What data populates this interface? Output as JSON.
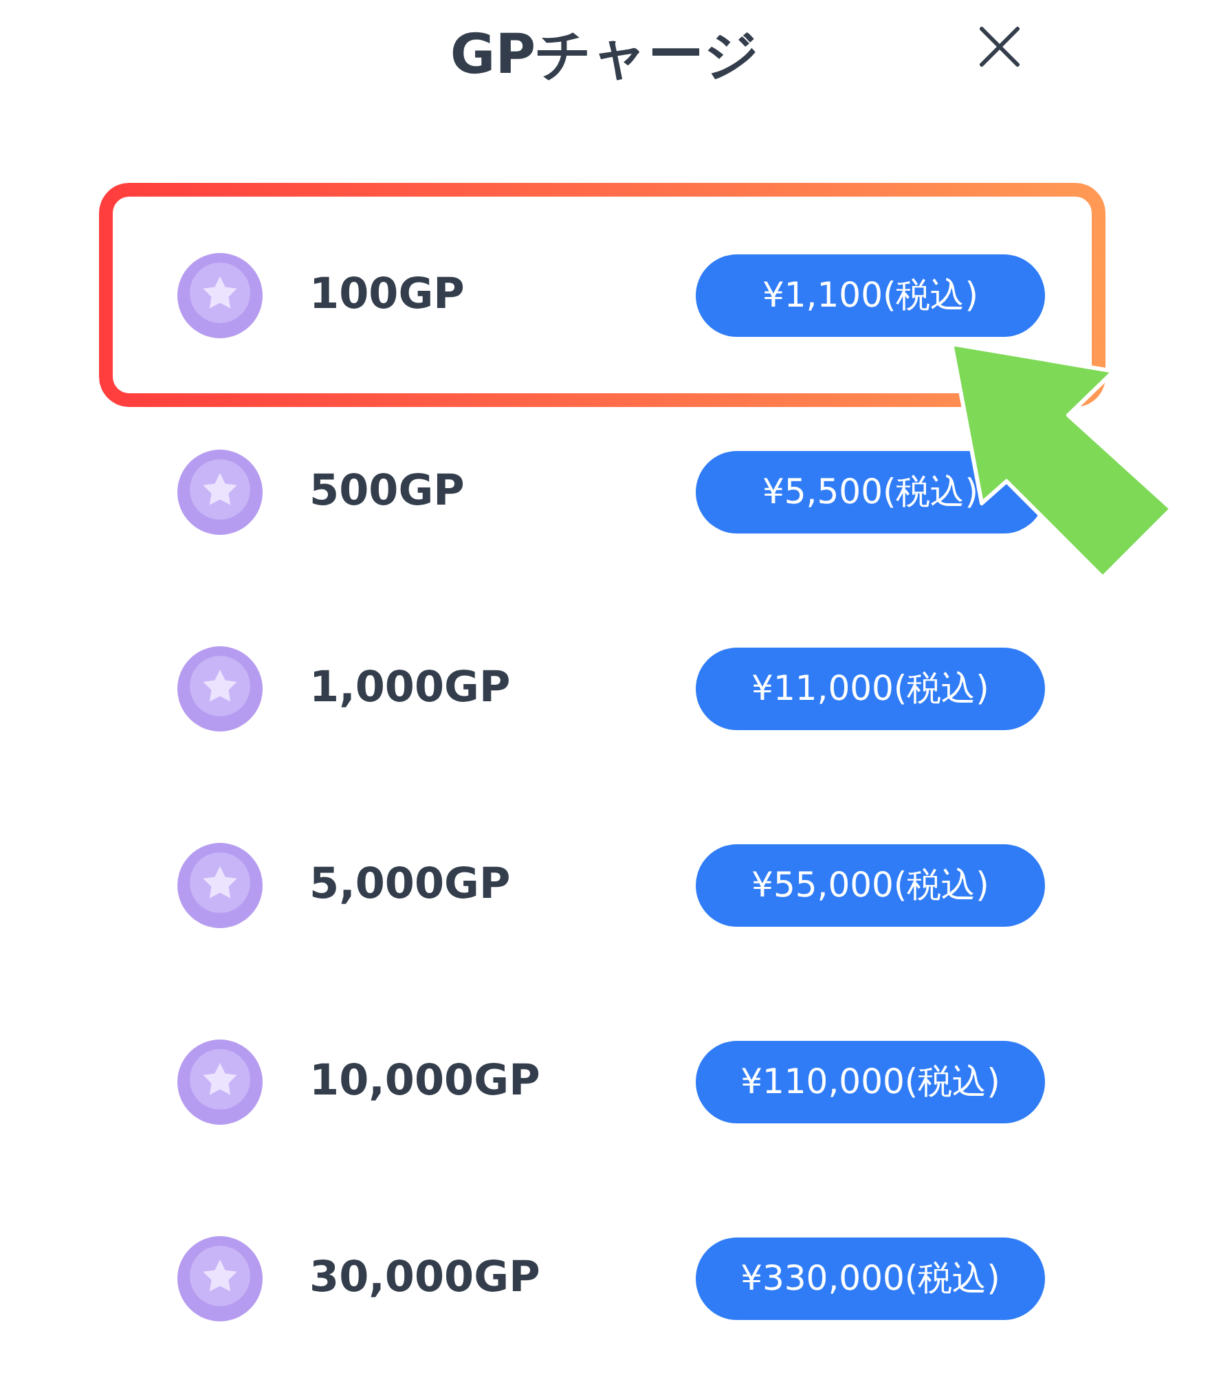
{
  "title": "GPチャージ",
  "items": [
    {
      "amount": "100GP",
      "price": "¥1,100(税込)",
      "highlighted": true
    },
    {
      "amount": "500GP",
      "price": "¥5,500(税込)",
      "highlighted": false
    },
    {
      "amount": "1,000GP",
      "price": "¥11,000(税込)",
      "highlighted": false
    },
    {
      "amount": "5,000GP",
      "price": "¥55,000(税込)",
      "highlighted": false
    },
    {
      "amount": "10,000GP",
      "price": "¥110,000(税込)",
      "highlighted": false
    },
    {
      "amount": "30,000GP",
      "price": "¥330,000(税込)",
      "highlighted": false
    }
  ]
}
